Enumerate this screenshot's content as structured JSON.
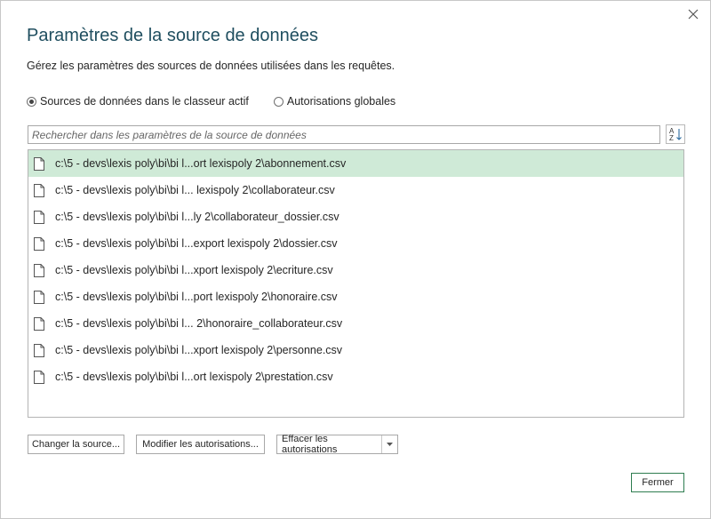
{
  "dialog": {
    "title": "Paramètres de la source de données",
    "subtitle": "Gérez les paramètres des sources de données utilisées dans les requêtes.",
    "close_icon": "close-icon"
  },
  "scope": {
    "options": [
      {
        "label": "Sources de données dans le classeur actif",
        "selected": true
      },
      {
        "label": "Autorisations globales",
        "selected": false
      }
    ]
  },
  "search": {
    "placeholder": "Rechercher dans les paramètres de la source de données",
    "value": ""
  },
  "sort_icon": "sort-az-icon",
  "sources": [
    {
      "path": "c:\\5 - devs\\lexis poly\\bi\\bi l...ort lexispoly 2\\abonnement.csv",
      "selected": true,
      "icon": "file-icon"
    },
    {
      "path": "c:\\5 - devs\\lexis poly\\bi\\bi l... lexispoly 2\\collaborateur.csv",
      "selected": false,
      "icon": "file-icon"
    },
    {
      "path": "c:\\5 - devs\\lexis poly\\bi\\bi l...ly 2\\collaborateur_dossier.csv",
      "selected": false,
      "icon": "file-icon"
    },
    {
      "path": "c:\\5 - devs\\lexis poly\\bi\\bi l...export lexispoly 2\\dossier.csv",
      "selected": false,
      "icon": "file-icon"
    },
    {
      "path": "c:\\5 - devs\\lexis poly\\bi\\bi l...xport lexispoly 2\\ecriture.csv",
      "selected": false,
      "icon": "file-icon"
    },
    {
      "path": "c:\\5 - devs\\lexis poly\\bi\\bi l...port lexispoly 2\\honoraire.csv",
      "selected": false,
      "icon": "file-icon"
    },
    {
      "path": "c:\\5 - devs\\lexis poly\\bi\\bi l... 2\\honoraire_collaborateur.csv",
      "selected": false,
      "icon": "file-icon"
    },
    {
      "path": "c:\\5 - devs\\lexis poly\\bi\\bi l...xport lexispoly 2\\personne.csv",
      "selected": false,
      "icon": "file-icon"
    },
    {
      "path": "c:\\5 - devs\\lexis poly\\bi\\bi l...ort lexispoly 2\\prestation.csv",
      "selected": false,
      "icon": "file-icon"
    }
  ],
  "actions": {
    "change_source": "Changer la source...",
    "modify_permissions": "Modifier les autorisations...",
    "clear_permissions": "Effacer les autorisations",
    "clear_dropdown_icon": "chevron-down-icon"
  },
  "footer": {
    "close_label": "Fermer"
  },
  "colors": {
    "title": "#1f4e5f",
    "selection": "#cfead7",
    "primary_border": "#2e7d50"
  }
}
